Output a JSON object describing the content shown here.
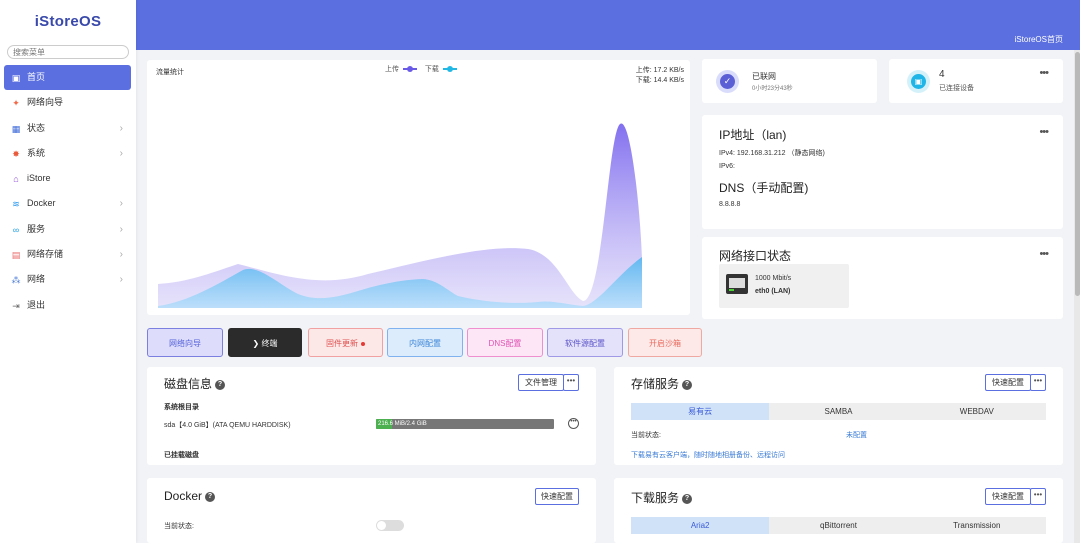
{
  "app": {
    "logo": "iStoreOS",
    "header_link": "iStoreOS首页"
  },
  "sidebar": {
    "search_placeholder": "搜索菜单",
    "items": [
      {
        "label": "首页",
        "icon": "home-icon",
        "active": true,
        "has_submenu": false
      },
      {
        "label": "网络向导",
        "icon": "wizard-icon",
        "active": false,
        "has_submenu": false
      },
      {
        "label": "状态",
        "icon": "status-icon",
        "active": false,
        "has_submenu": true
      },
      {
        "label": "系统",
        "icon": "system-icon",
        "active": false,
        "has_submenu": true
      },
      {
        "label": "iStore",
        "icon": "store-icon",
        "active": false,
        "has_submenu": false
      },
      {
        "label": "Docker",
        "icon": "docker-icon",
        "active": false,
        "has_submenu": true
      },
      {
        "label": "服务",
        "icon": "services-icon",
        "active": false,
        "has_submenu": true
      },
      {
        "label": "网络存储",
        "icon": "nas-icon",
        "active": false,
        "has_submenu": true
      },
      {
        "label": "网络",
        "icon": "network-icon",
        "active": false,
        "has_submenu": true
      },
      {
        "label": "退出",
        "icon": "logout-icon",
        "active": false,
        "has_submenu": false
      }
    ]
  },
  "traffic": {
    "title": "流量统计",
    "legend_up": "上传",
    "legend_down": "下载",
    "up_rate": "上传: 17.2 KB/s",
    "down_rate": "下载: 14.4 KB/s",
    "colors": {
      "upload": "#7b68ee",
      "download": "#22b8e6"
    }
  },
  "actions": [
    {
      "label": "网络向导",
      "bg": "#ddddfb",
      "border": "#7b7fe0",
      "color": "#5561d8"
    },
    {
      "label": "❯ 终端",
      "bg": "#2b2b2b",
      "border": "#2b2b2b",
      "color": "#ffffff"
    },
    {
      "label": "固件更新",
      "bg": "#fde8e8",
      "border": "#f1a1a1",
      "color": "#e05252"
    },
    {
      "label": "内网配置",
      "bg": "#dcecfc",
      "border": "#7fb2ee",
      "color": "#3d86d8"
    },
    {
      "label": "DNS配置",
      "bg": "#fde6f5",
      "border": "#ef8fd0",
      "color": "#e052b4"
    },
    {
      "label": "软件源配置",
      "bg": "#e4e2fa",
      "border": "#9f99e6",
      "color": "#5d55c9"
    },
    {
      "label": "开启沙箱",
      "bg": "#fde9e8",
      "border": "#f0a8a3",
      "color": "#e86a5e"
    }
  ],
  "status": {
    "online_label": "已联网",
    "uptime": "0小时23分43秒",
    "devices_count": "4",
    "devices_label": "已连接设备"
  },
  "ip": {
    "title": "IP地址（lan)",
    "ipv4": "IPv4: 192.168.31.212 （静态网络)",
    "ipv6": "IPv6:",
    "dns_title": "DNS（手动配置)",
    "dns": "8.8.8.8"
  },
  "ports": {
    "title": "网络接口状态",
    "speed": "1000 Mbit/s",
    "name": "eth0 (LAN)"
  },
  "disk": {
    "title": "磁盘信息",
    "manage_btn": "文件管理",
    "root_label": "系统根目录",
    "disk_name": "sda【4.0 GiB】(ATA QEMU HARDDISK)",
    "usage": "216.6 MiB/2.4 GiB",
    "usage_fraction": 0.09,
    "mounted_label": "已挂载磁盘"
  },
  "storage": {
    "title": "存储服务",
    "quick_btn": "快速配置",
    "tabs": [
      "易有云",
      "SAMBA",
      "WEBDAV"
    ],
    "status_label": "当前状态:",
    "status_value": "未配置",
    "link": "下载易有云客户端，随时随地相册备份、远程访问"
  },
  "docker": {
    "title": "Docker",
    "quick_btn": "快速配置",
    "status_label": "当前状态:"
  },
  "download": {
    "title": "下载服务",
    "quick_btn": "快速配置",
    "tabs": [
      "Aria2",
      "qBittorrent",
      "Transmission"
    ]
  }
}
